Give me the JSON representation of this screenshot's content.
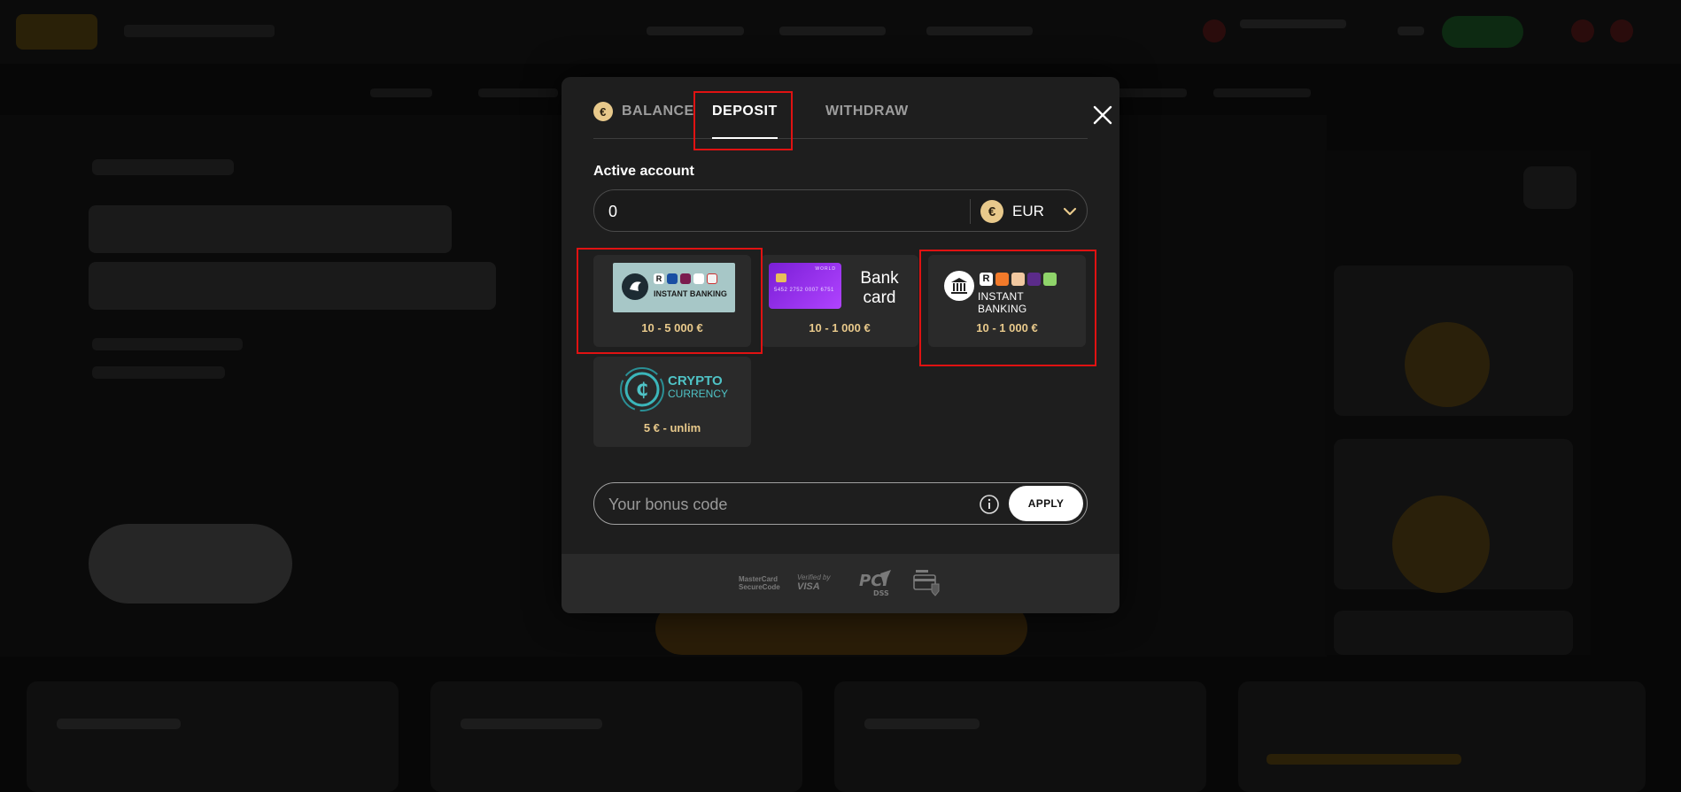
{
  "tabs": {
    "balance_label": "BALANCE",
    "deposit_label": "DEPOSIT",
    "withdraw_label": "WITHDRAW",
    "active": "DEPOSIT"
  },
  "active_account": {
    "label": "Active account",
    "amount": "0",
    "currency": "EUR",
    "currency_symbol": "€"
  },
  "payment_methods": [
    {
      "name": "Instant Banking",
      "logo_text": "INSTANT BANKING",
      "range": "10 - 5 000 €",
      "selected": true
    },
    {
      "name": "Bank card",
      "logo_text": "Bank card",
      "range": "10 - 1 000 €",
      "selected": false
    },
    {
      "name": "Instant Banking",
      "logo_text": "INSTANT BANKING",
      "range": "10 - 1 000 €",
      "selected": true
    },
    {
      "name": "Crypto Currency",
      "logo_text_1": "CRYPTO",
      "logo_text_2": "CURRENCY",
      "range": "5 € - unlim",
      "selected": false
    }
  ],
  "bonus": {
    "placeholder": "Your bonus code",
    "apply_label": "APPLY"
  },
  "trust_badges": {
    "mastercard_1": "MasterCard",
    "mastercard_2": "SecureCode",
    "visa_1": "Verified by",
    "visa_2": "VISA",
    "pci": "PCI DSS"
  },
  "colors": {
    "accent_gold": "#e8c98b",
    "modal_bg": "#1e1e1e",
    "highlight_red": "#e01212"
  }
}
